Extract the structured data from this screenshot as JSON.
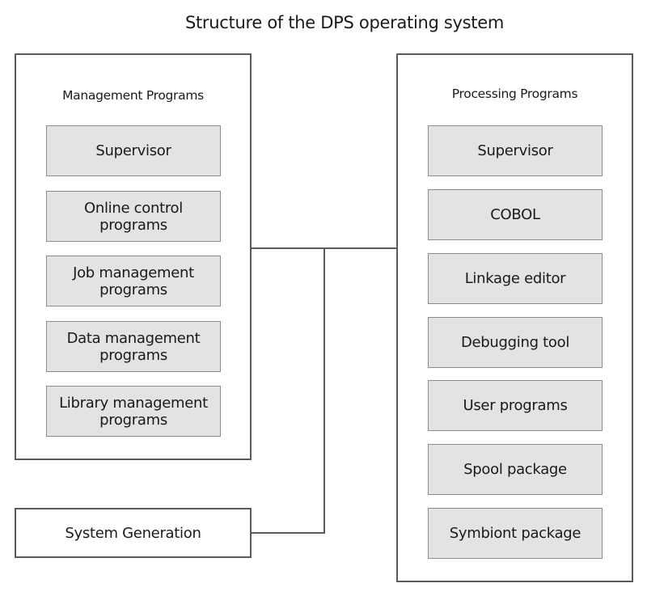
{
  "title": "Structure of the DPS operating system",
  "management": {
    "label": "Management Programs",
    "items": [
      "Supervisor",
      "Online control\nprograms",
      "Job management\nprograms",
      "Data management\nprograms",
      "Library management\nprograms"
    ]
  },
  "processing": {
    "label": "Processing Programs",
    "items": [
      "Supervisor",
      "COBOL",
      "Linkage editor",
      "Debugging tool",
      "User programs",
      "Spool package",
      "Symbiont package"
    ]
  },
  "system_generation": {
    "label": "System Generation"
  },
  "colors": {
    "box_fill": "#e3e3e3",
    "border": "#5e5858",
    "item_border": "#8a8d8d"
  }
}
